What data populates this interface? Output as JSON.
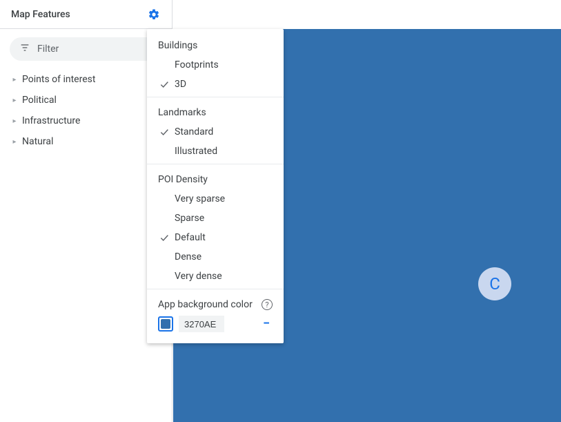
{
  "sidebar": {
    "title": "Map Features",
    "filter_placeholder": "Filter",
    "items": [
      {
        "label": "Points of interest"
      },
      {
        "label": "Political"
      },
      {
        "label": "Infrastructure"
      },
      {
        "label": "Natural"
      }
    ]
  },
  "settings_menu": {
    "sections": [
      {
        "heading": "Buildings",
        "options": [
          {
            "label": "Footprints",
            "selected": false
          },
          {
            "label": "3D",
            "selected": true
          }
        ]
      },
      {
        "heading": "Landmarks",
        "options": [
          {
            "label": "Standard",
            "selected": true
          },
          {
            "label": "Illustrated",
            "selected": false
          }
        ]
      },
      {
        "heading": "POI Density",
        "options": [
          {
            "label": "Very sparse",
            "selected": false
          },
          {
            "label": "Sparse",
            "selected": false
          },
          {
            "label": "Default",
            "selected": true
          },
          {
            "label": "Dense",
            "selected": false
          },
          {
            "label": "Very dense",
            "selected": false
          }
        ]
      }
    ],
    "bg_color": {
      "label": "App background color",
      "value": "3270AE",
      "hex": "#3270AE"
    }
  },
  "map": {
    "background": "#3270AE",
    "avatar_letter": "C"
  }
}
